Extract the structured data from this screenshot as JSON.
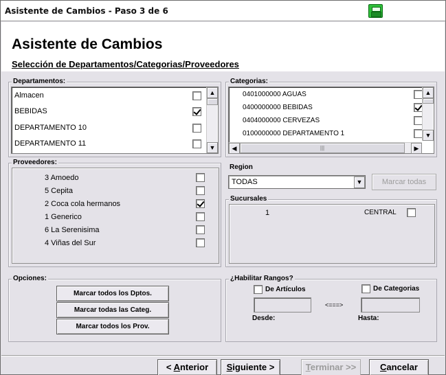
{
  "window": {
    "title": "Asistente de Cambios - Paso 3 de 6"
  },
  "header": {
    "title": "Asistente de Cambios",
    "subtitle": "Selección de Departamentos/Categorias/Proveedores"
  },
  "departamentos": {
    "label": "Departamentos:",
    "items": [
      {
        "label": "Almacen",
        "checked": false
      },
      {
        "label": "BEBIDAS",
        "checked": true
      },
      {
        "label": "DEPARTAMENTO 10",
        "checked": false
      },
      {
        "label": "DEPARTAMENTO 11",
        "checked": false
      }
    ]
  },
  "categorias": {
    "label": "Categorias:",
    "items": [
      {
        "label": "0401000000 AGUAS",
        "checked": false
      },
      {
        "label": "0400000000 BEBIDAS",
        "checked": true
      },
      {
        "label": "0404000000 CERVEZAS",
        "checked": false
      },
      {
        "label": "0100000000 DEPARTAMENTO 1",
        "checked": false
      }
    ]
  },
  "proveedores": {
    "label": "Proveedores:",
    "items": [
      {
        "label": "3 Amoedo",
        "checked": false
      },
      {
        "label": "5 Cepita",
        "checked": false
      },
      {
        "label": "2 Coca cola hermanos",
        "checked": true
      },
      {
        "label": "1 Generico",
        "checked": false
      },
      {
        "label": "6 La Serenisima",
        "checked": false
      },
      {
        "label": "4 Viñas del Sur",
        "checked": false
      }
    ]
  },
  "region": {
    "label": "Region",
    "selected": "TODAS",
    "mark_all_label": "Marcar todas"
  },
  "sucursales": {
    "label": "Sucursales",
    "rows": [
      {
        "id": "1",
        "name": "CENTRAL",
        "checked": false
      }
    ]
  },
  "opciones": {
    "label": "Opciones:",
    "buttons": {
      "dptos": "Marcar todos los Dptos.",
      "categ": "Marcar todas las Categ.",
      "prov": "Marcar todos los Prov."
    }
  },
  "rangos": {
    "label": "¿Habilitar Rangos?",
    "articulos_label": "De Artículos",
    "categorias_label": "De Categorias",
    "arrow": "<===>",
    "desde_label": "Desde:",
    "hasta_label": "Hasta:"
  },
  "footer": {
    "prev": {
      "key": "A",
      "rest": "nterior",
      "prefix": "< "
    },
    "next": {
      "key": "S",
      "rest": "iguiente",
      "suffix": " >"
    },
    "finish": {
      "key": "T",
      "rest": "erminar",
      "suffix": " >>"
    },
    "cancel": {
      "key": "C",
      "rest": "ancelar"
    }
  }
}
